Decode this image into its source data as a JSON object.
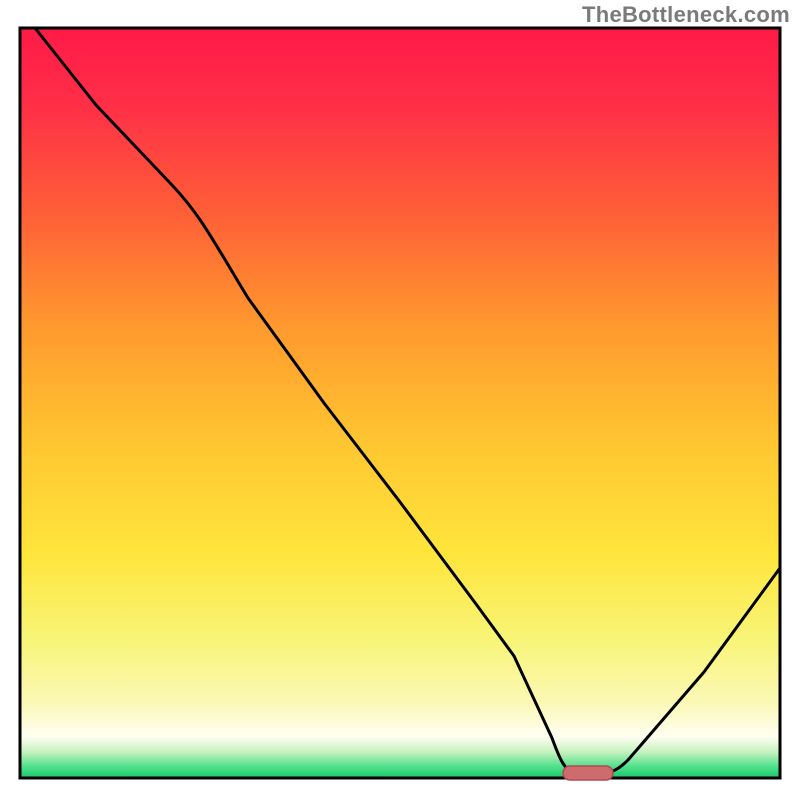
{
  "watermark": "TheBottleneck.com",
  "colors": {
    "top": "#ff1a47",
    "orange": "#ff7a2a",
    "yellow": "#ffe83b",
    "paleyellow": "#fbf8b6",
    "white_band": "#fefff1",
    "green": "#2ddc76",
    "frame": "#000000",
    "curve": "#000000",
    "marker_fill": "#ce6b6e",
    "marker_stroke": "#b44a50"
  },
  "chart_data": {
    "type": "line",
    "title": "",
    "xlabel": "",
    "ylabel": "",
    "xlim": [
      0,
      100
    ],
    "ylim": [
      0,
      100
    ],
    "x": [
      2,
      10,
      20,
      25,
      30,
      40,
      50,
      60,
      65,
      70,
      72,
      75,
      80,
      90,
      100
    ],
    "values": [
      100,
      90,
      79,
      73,
      64,
      50,
      37,
      23,
      16,
      5,
      1,
      0.5,
      2,
      14,
      28
    ],
    "marker": {
      "x_start": 70,
      "x_end": 77,
      "y": 0.5
    },
    "notes": "V-shaped bottleneck curve; minimum near x≈74; no axis tick labels shown."
  }
}
